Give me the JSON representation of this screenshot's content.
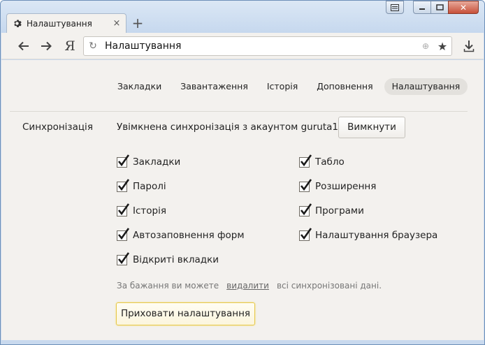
{
  "window": {
    "close_symbol": "✕",
    "min_symbol": "–",
    "max_symbol": "□"
  },
  "tab": {
    "title": "Налаштування",
    "icon": "gear-icon",
    "close_symbol": "×"
  },
  "new_tab_symbol": "+",
  "toolbar": {
    "yandex_logo": "Я",
    "address": "Налаштування",
    "back_symbol": "←",
    "forward_symbol": "→",
    "reload_symbol": "↻",
    "star_symbol": "★",
    "globe_symbol": "⊕"
  },
  "nav": {
    "tabs": [
      {
        "label": "Закладки",
        "active": false
      },
      {
        "label": "Завантаження",
        "active": false
      },
      {
        "label": "Історія",
        "active": false
      },
      {
        "label": "Доповнення",
        "active": false
      },
      {
        "label": "Налаштування",
        "active": true
      }
    ]
  },
  "sync": {
    "section_title": "Синхронізація",
    "status_text": "Увімкнена синхронізація з акаунтом guruta1.",
    "disable_button": "Вимкнути",
    "left_items": [
      {
        "label": "Закладки",
        "checked": true
      },
      {
        "label": "Паролі",
        "checked": true
      },
      {
        "label": "Історія",
        "checked": true
      },
      {
        "label": "Автозаповнення форм",
        "checked": true
      },
      {
        "label": "Відкриті вкладки",
        "checked": true
      }
    ],
    "right_items": [
      {
        "label": "Табло",
        "checked": true
      },
      {
        "label": "Розширення",
        "checked": true
      },
      {
        "label": "Програми",
        "checked": true
      },
      {
        "label": "Налаштування браузера",
        "checked": true
      }
    ],
    "note_prefix": "За бажання ви можете",
    "note_link": "видалити",
    "note_suffix": "всі синхронізовані дані.",
    "hide_button": "Приховати налаштування"
  },
  "colors": {
    "accent_border": "#e6c84a",
    "page_bg": "#f3f1ee",
    "frame": "#c9d9ee"
  }
}
